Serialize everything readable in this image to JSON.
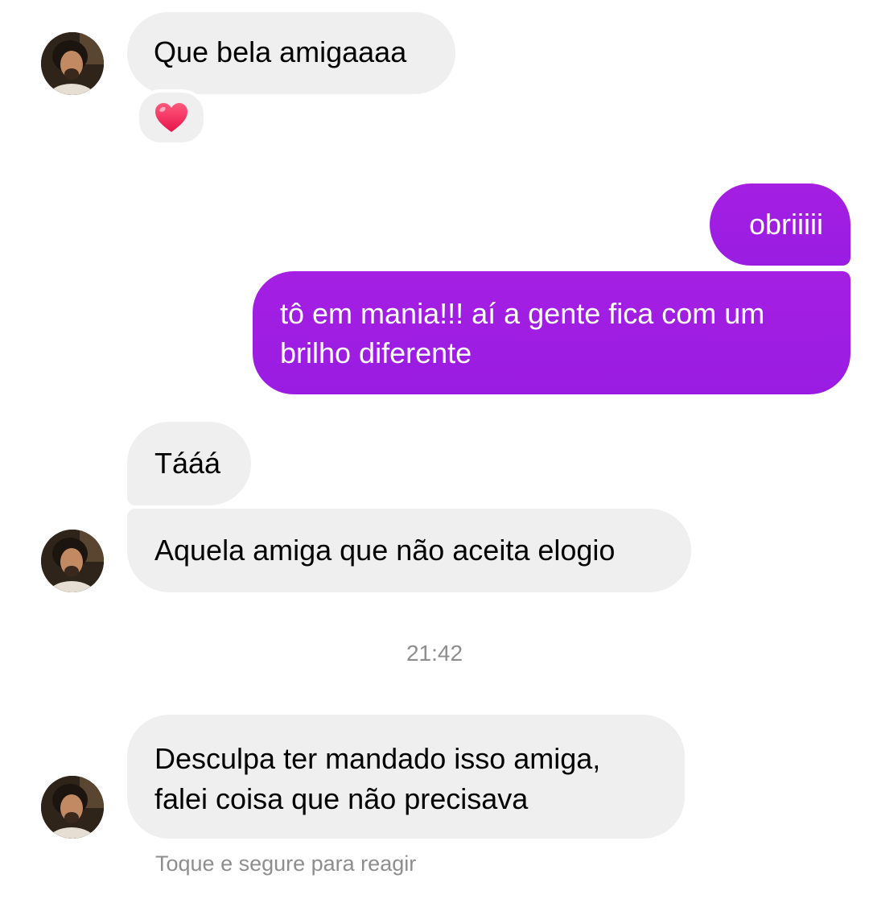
{
  "messages": [
    {
      "text": "Que bela amigaaaa",
      "reaction": "red-heart"
    },
    {
      "text": "obriiiii"
    },
    {
      "text": "tô em mania!!! aí a gente fica com um brilho diferente"
    },
    {
      "text": "Tááá"
    },
    {
      "text": "Aquela amiga que não aceita elogio"
    },
    {
      "text": "Desculpa ter mandado isso amiga, falei coisa que não precisava"
    }
  ],
  "timestamp": "21:42",
  "hint": "Toque e segure para reagir",
  "colors": {
    "incoming_bubble": "#efefef",
    "outgoing_bubble": "#a11be0",
    "meta_text": "#8e8e8e",
    "heart": "#f0245a"
  }
}
